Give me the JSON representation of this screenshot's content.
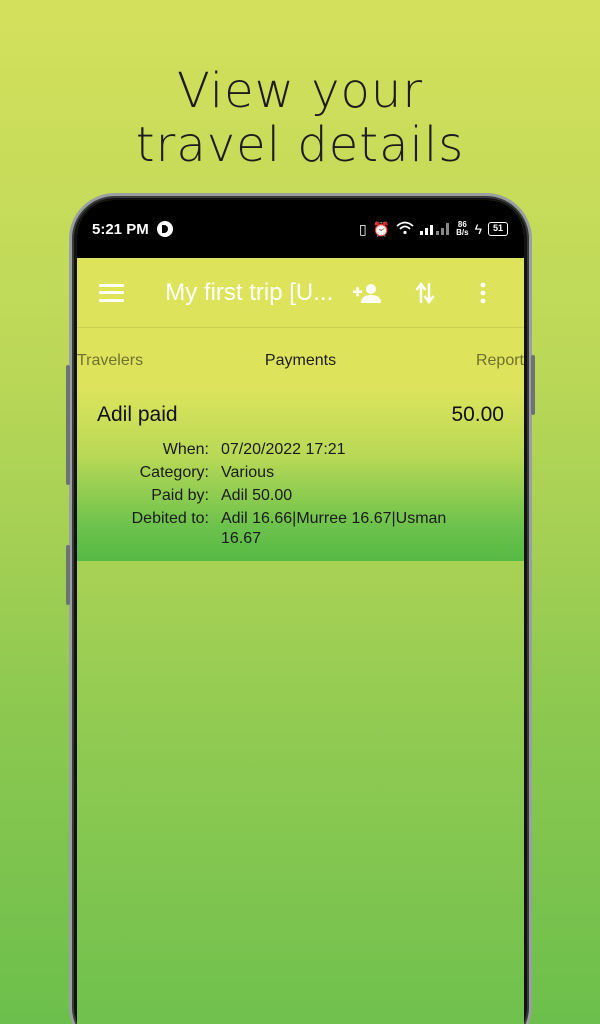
{
  "headline": {
    "line1": "View your",
    "line2": "travel details"
  },
  "status_bar": {
    "time": "5:21 PM",
    "icons": [
      "vibrate-icon",
      "alarm-icon",
      "wifi-icon",
      "signal-icon"
    ],
    "net_speed_value": "86",
    "net_speed_unit": "B/s",
    "battery": "51"
  },
  "app_bar": {
    "title": "My first trip [U...",
    "actions": [
      "add-person-icon",
      "swap-icon",
      "more-icon"
    ]
  },
  "tabs": {
    "travelers": "Travelers",
    "payments": "Payments",
    "report": "Report"
  },
  "payment": {
    "title": "Adil paid",
    "amount": "50.00",
    "when_label": "When:",
    "when": "07/20/2022 17:21",
    "category_label": "Category:",
    "category": "Various",
    "paid_by_label": "Paid by:",
    "paid_by": "Adil 50.00",
    "debited_to_label": "Debited to:",
    "debited_to": "Adil 16.66|Murree 16.67|Usman 16.67"
  },
  "colors": {
    "app_bar": "#dde45c",
    "background_top": "#d3e05c",
    "background_bottom": "#6cbf4c"
  }
}
